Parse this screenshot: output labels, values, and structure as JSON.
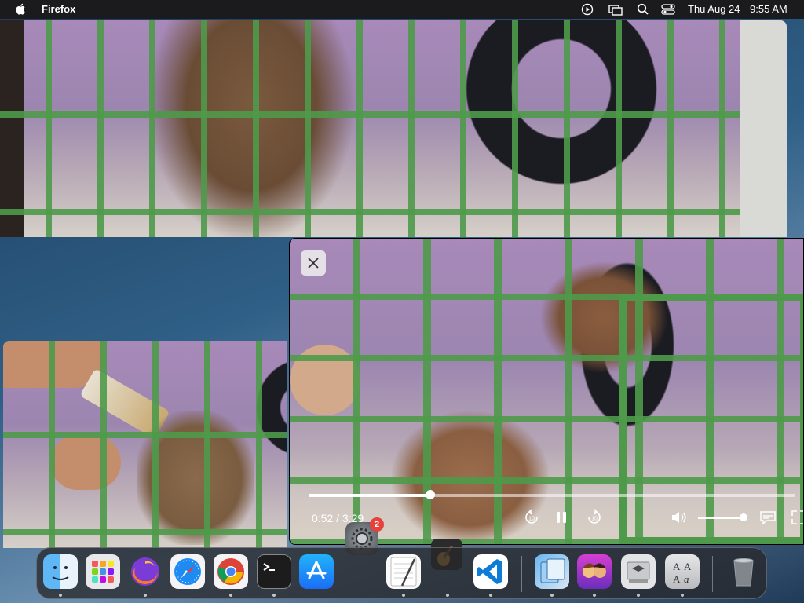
{
  "menubar": {
    "app_name": "Firefox",
    "date": "Thu Aug 24",
    "time": "9:55 AM",
    "status_icons": [
      "play-circle-icon",
      "screen-mirroring-icon",
      "search-icon",
      "control-center-icon"
    ]
  },
  "pip_player": {
    "time_display": "0:52 / 3:29",
    "progress_fraction": 0.25,
    "volume_fraction": 1.0,
    "controls": [
      "close-icon",
      "skip-back-icon",
      "pause-icon",
      "skip-forward-icon",
      "volume-icon",
      "subtitles-icon",
      "fullscreen-icon"
    ]
  },
  "dock": {
    "apps": [
      {
        "name": "Finder",
        "icon": "finder-icon",
        "running": true
      },
      {
        "name": "Launchpad",
        "icon": "launchpad-icon",
        "running": false
      },
      {
        "name": "Firefox",
        "icon": "firefox-icon",
        "running": true
      },
      {
        "name": "Safari",
        "icon": "safari-icon",
        "running": false
      },
      {
        "name": "Chrome",
        "icon": "chrome-icon",
        "running": true
      },
      {
        "name": "Terminal",
        "icon": "terminal-icon",
        "running": true
      },
      {
        "name": "App Store",
        "icon": "app-store-icon",
        "running": false
      },
      {
        "name": "System Settings",
        "icon": "system-settings-icon",
        "running": false,
        "badge": "2"
      },
      {
        "name": "TextEdit",
        "icon": "textedit-icon",
        "running": true
      },
      {
        "name": "GarageBand",
        "icon": "garageband-icon",
        "running": true
      },
      {
        "name": "Visual Studio Code",
        "icon": "vscode-icon",
        "running": true
      },
      {
        "name": "Preview",
        "icon": "preview-icon",
        "running": true
      },
      {
        "name": "Game",
        "icon": "game-icon",
        "running": true
      },
      {
        "name": "Boot Camp Assistant",
        "icon": "bootcamp-icon",
        "running": true
      },
      {
        "name": "Font Book",
        "icon": "font-book-icon",
        "running": true
      },
      {
        "name": "Trash",
        "icon": "trash-icon",
        "running": false
      }
    ],
    "system_settings_badge": "2"
  },
  "colors": {
    "menubar_bg": "#1b1b1d",
    "cage_green": "#4e9a4a",
    "badge_red": "#e6413b"
  }
}
